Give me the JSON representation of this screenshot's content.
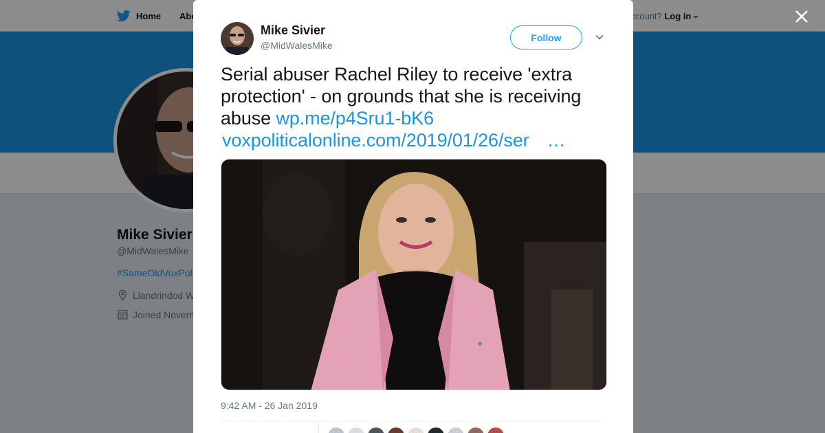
{
  "nav": {
    "home_label": "Home",
    "about_label": "Abo",
    "account_prompt": "account?",
    "login_label": "Log in"
  },
  "profile": {
    "name": "Mike Sivier",
    "handle": "@MidWalesMike",
    "bio": "#SameOldVoxPol",
    "location": "Llandrindod W",
    "joined": "Joined Novem"
  },
  "tweet": {
    "author_name": "Mike Sivier",
    "author_handle": "@MidWalesMike",
    "follow_label": "Follow",
    "text": "Serial abuser Rachel Riley to receive 'extra protection' - on grounds that she is receiving abuse ",
    "link1": "wp.me/p4Sru1-bK6",
    "link2": "voxpoliticalonline.com/2019/01/26/ser",
    "link2_ellipsis": "…",
    "timestamp": "9:42 AM - 26 Jan 2019"
  },
  "icons": {
    "twitter": "twitter-bird-icon",
    "close": "close-icon",
    "chevron": "chevron-down-icon",
    "location": "location-pin-icon",
    "calendar": "calendar-icon"
  },
  "colors": {
    "brand_blue": "#1da1f2",
    "banner_blue": "#1b95e0",
    "link_blue": "#1b95e0",
    "coat_pink": "#e3a2b6"
  },
  "liker_colors": [
    "#b9c6cf",
    "#d7dde2",
    "#4b5560",
    "#6a3b2e",
    "#e9dcd4",
    "#1d2a2e",
    "#c9cfd6",
    "#8d6a5b",
    "#b44c4c"
  ]
}
